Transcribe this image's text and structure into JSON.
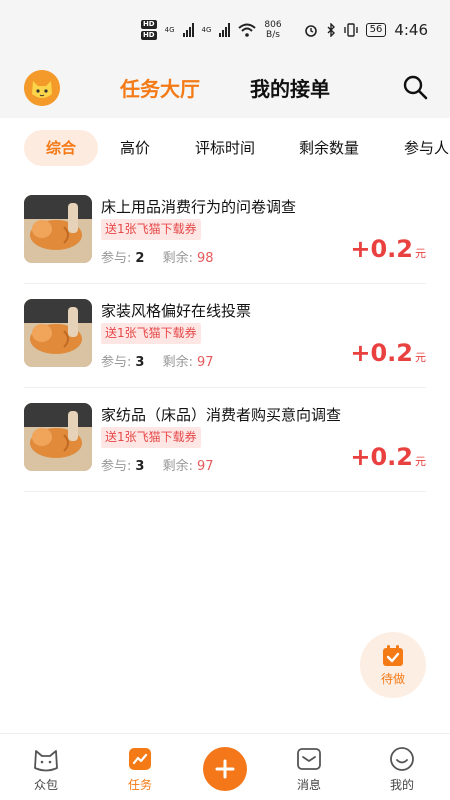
{
  "status_bar": {
    "hd1": "HD",
    "hd2": "HD",
    "net1": "4G",
    "net2": "4G",
    "speed_value": "806",
    "speed_unit": "B/s",
    "battery": "56",
    "time": "4:46"
  },
  "header": {
    "tab_hall": "任务大厅",
    "tab_orders": "我的接单",
    "active_color": "#f47a16"
  },
  "filters": [
    "综合",
    "高价",
    "评标时间",
    "剩余数量",
    "参与人"
  ],
  "tasks": [
    {
      "title": "床上用品消费行为的问卷调查",
      "tag": "送1张飞猫下载券",
      "participants_label": "参与:",
      "participants": "2",
      "remaining_label": "剩余:",
      "remaining": "98",
      "reward": "+0.2",
      "unit": "元"
    },
    {
      "title": "家装风格偏好在线投票",
      "tag": "送1张飞猫下载券",
      "participants_label": "参与:",
      "participants": "3",
      "remaining_label": "剩余:",
      "remaining": "97",
      "reward": "+0.2",
      "unit": "元"
    },
    {
      "title": "家纺品（床品）消费者购买意向调查",
      "tag": "送1张飞猫下载券",
      "participants_label": "参与:",
      "participants": "3",
      "remaining_label": "剩余:",
      "remaining": "97",
      "reward": "+0.2",
      "unit": "元"
    }
  ],
  "todo": {
    "label": "待做",
    "icon": "calendar-check-icon"
  },
  "bottom_nav": {
    "home": "众包",
    "tasks": "任务",
    "messages": "消息",
    "mine": "我的"
  }
}
